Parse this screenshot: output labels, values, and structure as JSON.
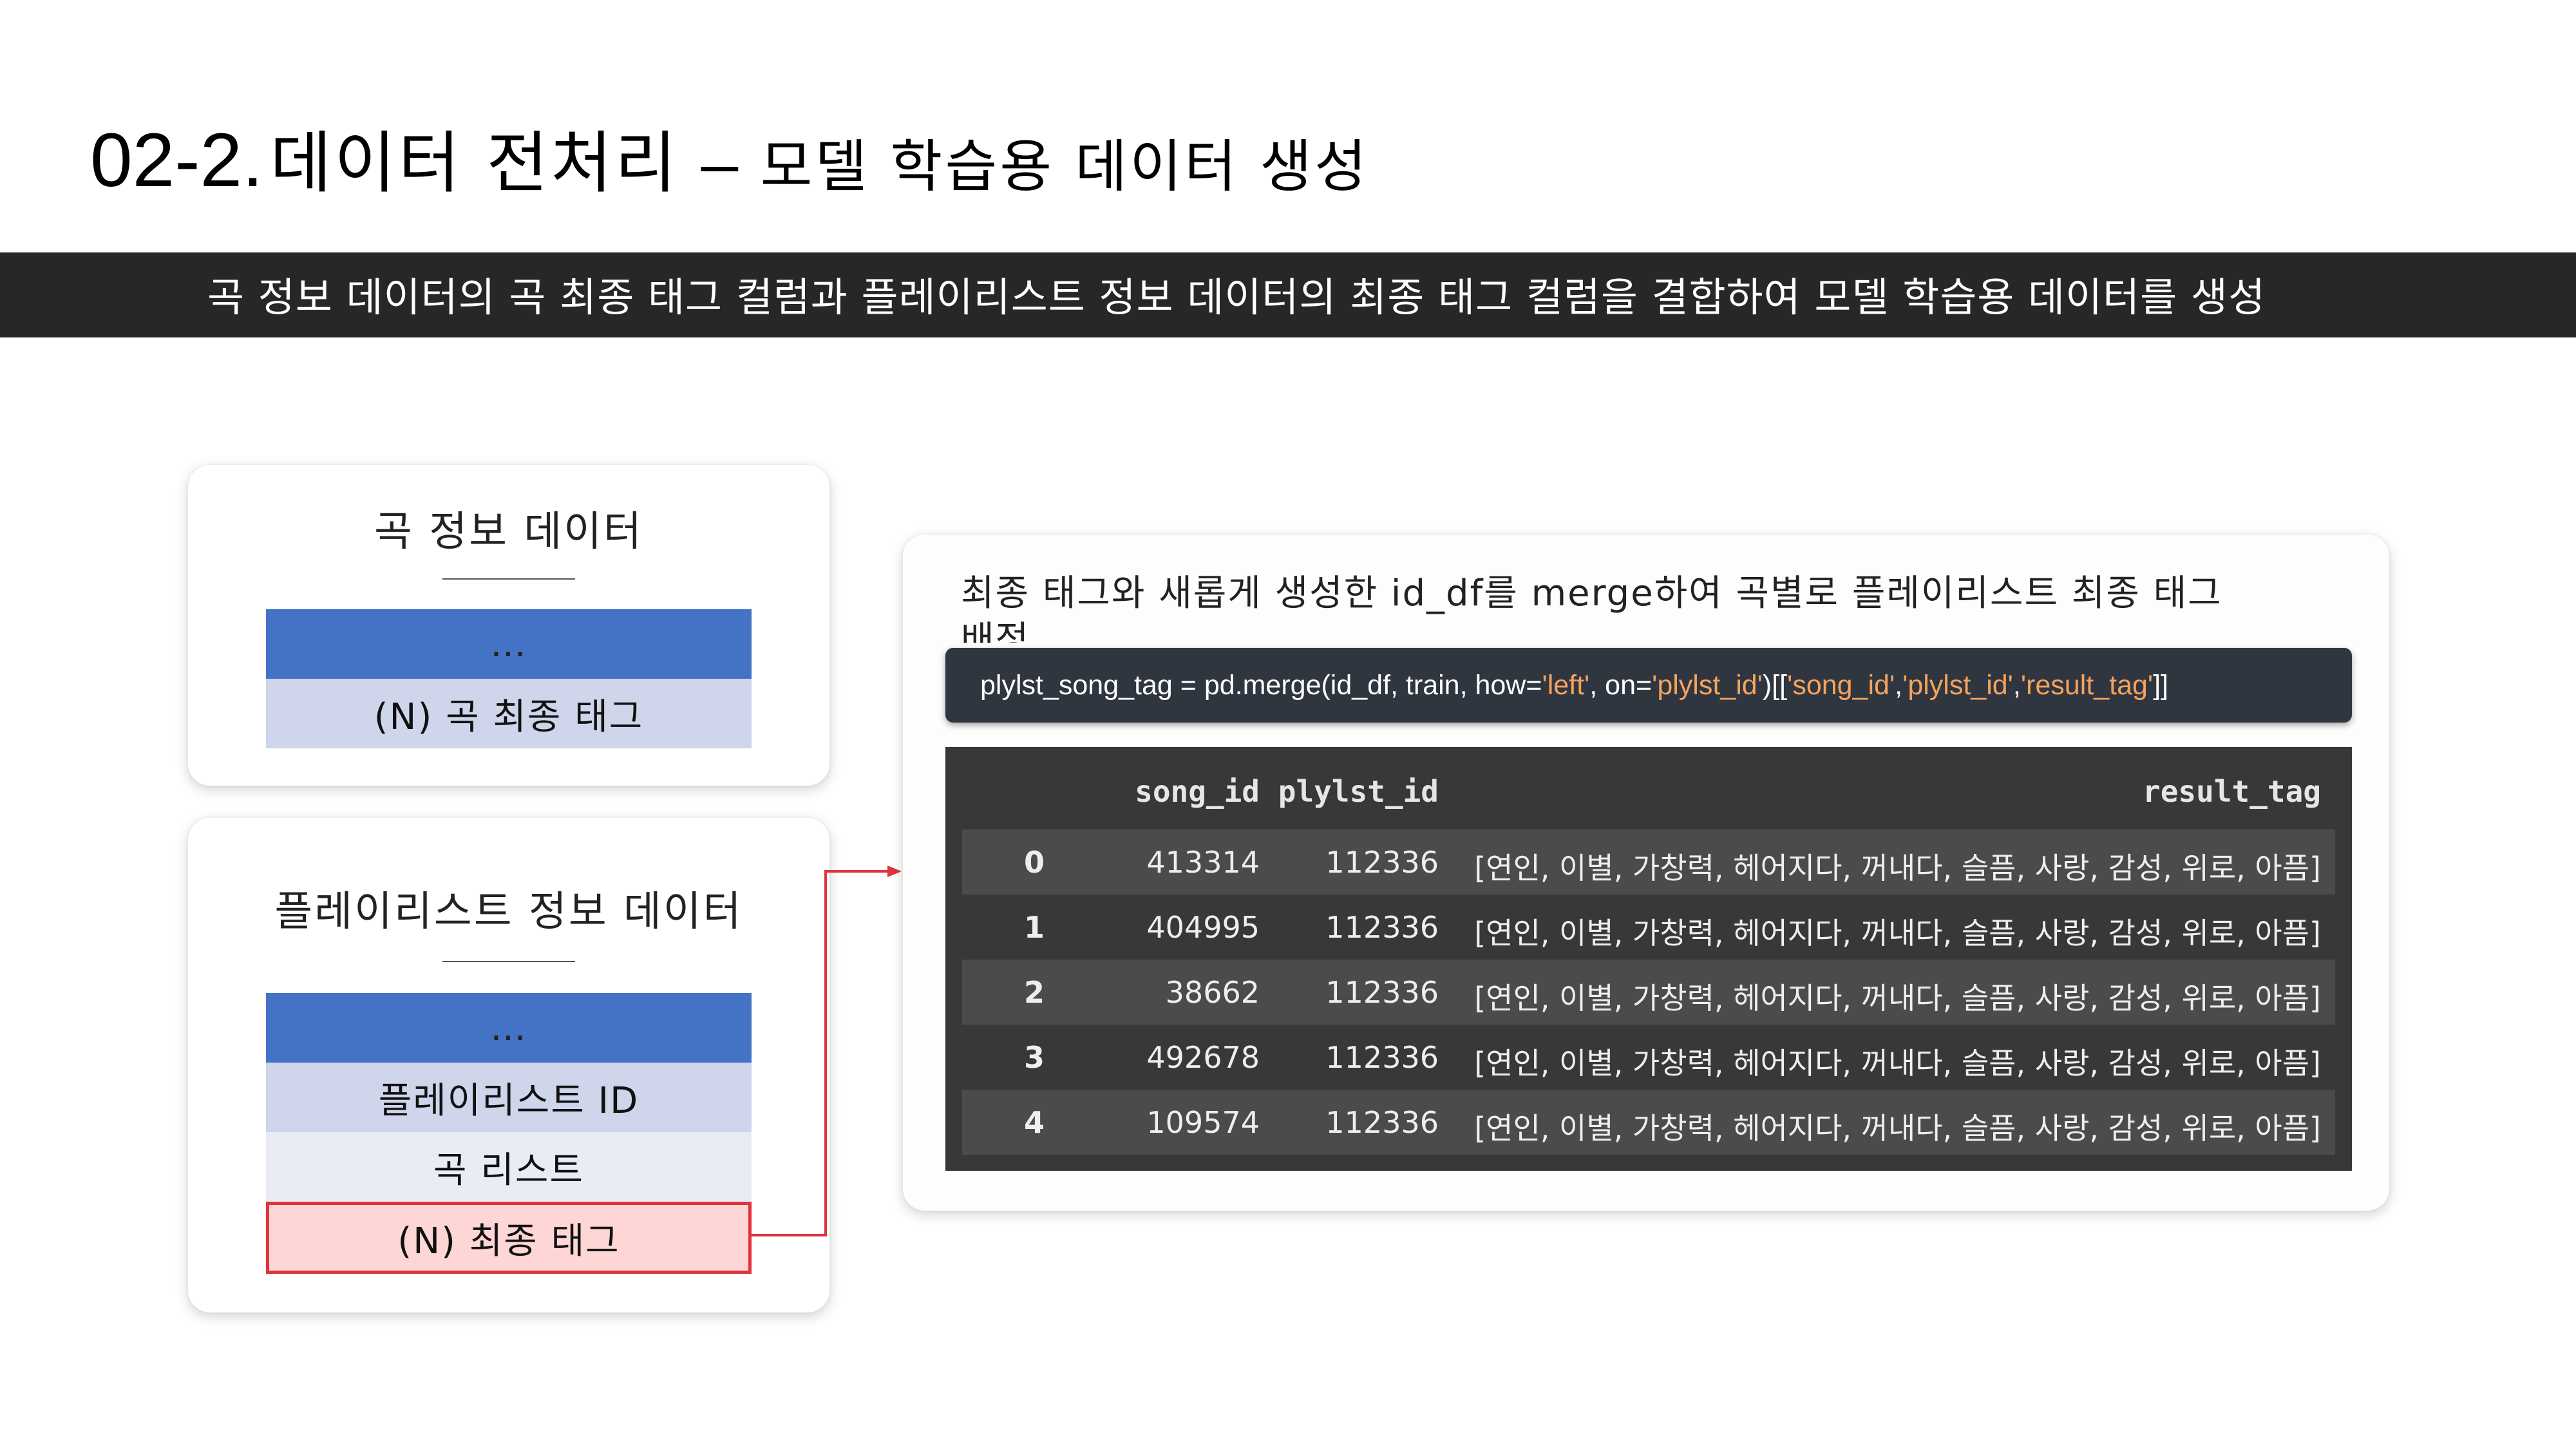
{
  "title": {
    "number": "02-2.",
    "main": "데이터 전처리",
    "dash": "–",
    "sub": "모델 학습용 데이터 생성"
  },
  "banner": {
    "text": "곡 정보 데이터의 곡 최종 태그 컬럼과 플레이리스트 정보 데이터의 최종 태그 컬럼을 결합하여 모델 학습용 데이터를 생성"
  },
  "song_card": {
    "title": "곡 정보 데이터",
    "rows": [
      "…",
      "(N) 곡 최종 태그"
    ]
  },
  "playlist_card": {
    "title": "플레이리스트 정보 데이터",
    "rows": [
      "…",
      "플레이리스트 ID",
      "곡 리스트",
      "(N) 최종 태그"
    ]
  },
  "result": {
    "description": "최종 태그와 새롭게 생성한 id_df를 merge하여 곡별로 플레이리스트 최종 태그 배정",
    "code": {
      "prefix": "plylst_song_tag = pd.merge(id_df, train, how=",
      "how": "'left'",
      "mid": ", on=",
      "on": "'plylst_id'",
      "open": ")[[",
      "col1": "'song_id'",
      "sep1": ", ",
      "col2": "'plylst_id'",
      "sep2": ", ",
      "col3": "'result_tag'",
      "close": "]]"
    },
    "table": {
      "columns": [
        "song_id",
        "plylst_id",
        "result_tag"
      ],
      "rows": [
        {
          "index": "0",
          "song_id": "413314",
          "plylst_id": "112336",
          "result_tag": "[연인, 이별, 가창력, 헤어지다, 꺼내다, 슬픔, 사랑, 감성, 위로, 아픔]"
        },
        {
          "index": "1",
          "song_id": "404995",
          "plylst_id": "112336",
          "result_tag": "[연인, 이별, 가창력, 헤어지다, 꺼내다, 슬픔, 사랑, 감성, 위로, 아픔]"
        },
        {
          "index": "2",
          "song_id": "38662",
          "plylst_id": "112336",
          "result_tag": "[연인, 이별, 가창력, 헤어지다, 꺼내다, 슬픔, 사랑, 감성, 위로, 아픔]"
        },
        {
          "index": "3",
          "song_id": "492678",
          "plylst_id": "112336",
          "result_tag": "[연인, 이별, 가창력, 헤어지다, 꺼내다, 슬픔, 사랑, 감성, 위로, 아픔]"
        },
        {
          "index": "4",
          "song_id": "109574",
          "plylst_id": "112336",
          "result_tag": "[연인, 이별, 가창력, 헤어지다, 꺼내다, 슬픔, 사랑, 감성, 위로, 아픔]"
        }
      ]
    }
  },
  "colors": {
    "banner_bg": "#272727",
    "row_blue": "#4472c4",
    "row_lavender": "#cfd5ea",
    "row_light": "#e9ebf5",
    "highlight_border": "#e03340",
    "highlight_fill": "#ffd6d6",
    "code_bg": "#2f3640",
    "code_string": "#f5a35c",
    "table_bg": "#383838"
  }
}
